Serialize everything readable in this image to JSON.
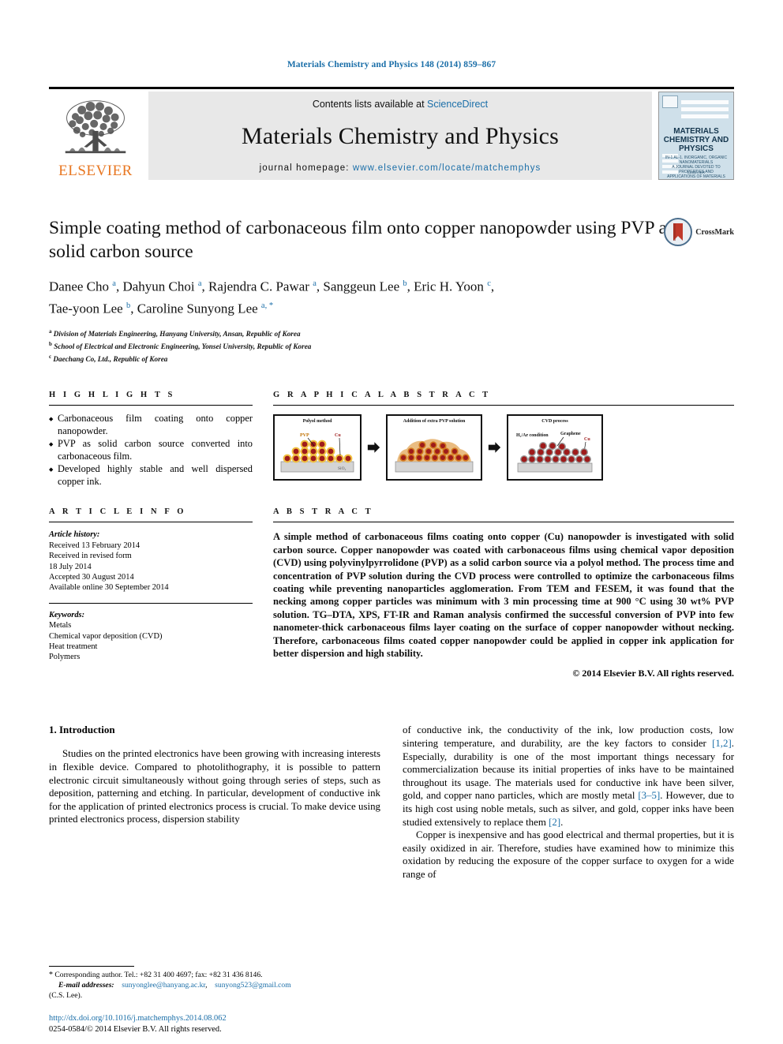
{
  "running_head": "Materials Chemistry and Physics 148 (2014) 859–867",
  "banner": {
    "publisher": "ELSEVIER",
    "contents_prefix": "Contents lists available at ",
    "contents_link": "ScienceDirect",
    "journal_title": "Materials Chemistry and Physics",
    "homepage_prefix": "journal homepage: ",
    "homepage_url": "www.elsevier.com/locate/matchemphys",
    "cover": {
      "title_line1": "MATERIALS",
      "title_line2": "CHEMISTRY AND",
      "title_line3": "PHYSICS",
      "sub_line1": "IN-1 AL-1. INORGANIC, ORGANIC",
      "sub_line2": "NANOMATERIALS",
      "sub_line3": "A JOURNAL DEVOTED TO PROPERTIES AND",
      "sub_line4": "APPLICATIONS OF MATERIALS SCIENCE",
      "footer": "ELSEVIER"
    }
  },
  "article": {
    "title": "Simple coating method of carbonaceous film onto copper nanopowder using PVP as solid carbon source",
    "crossmark_label": "CrossMark",
    "authors_line1": "Danee Cho <sup>a</sup>, Dahyun Choi <sup>a</sup>, Rajendra C. Pawar <sup>a</sup>, Sanggeun Lee <sup>b</sup>, Eric H. Yoon <sup>c</sup>,",
    "authors_line2": "Tae-yoon Lee <sup>b</sup>, Caroline Sunyong Lee <sup>a, *</sup>",
    "affiliations": [
      "<sup>a</sup> Division of Materials Engineering, Hanyang University, Ansan, Republic of Korea",
      "<sup>b</sup> School of Electrical and Electronic Engineering, Yonsei University, Republic of Korea",
      "<sup>c</sup> Daechang Co, Ltd., Republic of Korea"
    ]
  },
  "highlights": {
    "heading": "H I G H L I G H T S",
    "items": [
      "Carbonaceous film coating onto copper nanopowder.",
      "PVP as solid carbon source converted into carbonaceous film.",
      "Developed highly stable and well dispersed copper ink."
    ]
  },
  "graphical_abstract": {
    "heading": "G R A P H I C A L   A B S T R A C T",
    "panels": [
      {
        "caption": "Polyol method",
        "labels": [
          "PVP",
          "Cu",
          "SiO2"
        ]
      },
      {
        "caption": "Addition of extra PVP solution",
        "labels": []
      },
      {
        "caption": "CVD process",
        "labels": [
          "H2/Ar condition",
          "Graphene",
          "Cu"
        ]
      }
    ]
  },
  "article_info": {
    "heading": "A R T I C L E   I N F O",
    "history_label": "Article history:",
    "history": [
      "Received 13 February 2014",
      "Received in revised form",
      "18 July 2014",
      "Accepted 30 August 2014",
      "Available online 30 September 2014"
    ],
    "keywords_label": "Keywords:",
    "keywords": [
      "Metals",
      "Chemical vapor deposition (CVD)",
      "Heat treatment",
      "Polymers"
    ]
  },
  "abstract": {
    "heading": "A B S T R A C T",
    "text": "A simple method of carbonaceous films coating onto copper (Cu) nanopowder is investigated with solid carbon source. Copper nanopowder was coated with carbonaceous films using chemical vapor deposition (CVD) using polyvinylpyrrolidone (PVP) as a solid carbon source via a polyol method. The process time and concentration of PVP solution during the CVD process were controlled to optimize the carbonaceous films coating while preventing nanoparticles agglomeration. From TEM and FESEM, it was found that the necking among copper particles was minimum with 3 min processing time at 900 °C using 30 wt% PVP solution. TG–DTA, XPS, FT-IR and Raman analysis confirmed the successful conversion of PVP into few nanometer-thick carbonaceous films layer coating on the surface of copper nanopowder without necking. Therefore, carbonaceous films coated copper nanopowder could be applied in copper ink application for better dispersion and high stability.",
    "copyright": "© 2014 Elsevier B.V. All rights reserved."
  },
  "introduction": {
    "number_title": "1.  Introduction",
    "left_para": "Studies on the printed electronics have been growing with increasing interests in flexible device. Compared to photolithography, it is possible to pattern electronic circuit simultaneously without going through series of steps, such as deposition, patterning and etching. In particular, development of conductive ink for the application of printed electronics process is crucial. To make device using printed electronics process, dispersion stability",
    "right_para_1_a": "of conductive ink, the conductivity of the ink, low production costs, low sintering temperature, and durability, are the key factors to consider ",
    "right_para_1_ref1": "[1,2]",
    "right_para_1_b": ". Especially, durability is one of the most important things necessary for commercialization because its initial properties of inks have to be maintained throughout its usage. The materials used for conductive ink have been silver, gold, and copper nano particles, which are mostly metal ",
    "right_para_1_ref2": "[3–5]",
    "right_para_1_c": ". However, due to its high cost using noble metals, such as silver, and gold, copper inks have been studied extensively to replace them ",
    "right_para_1_ref3": "[2]",
    "right_para_1_d": ".",
    "right_para_2": "Copper is inexpensive and has good electrical and thermal properties, but it is easily oxidized in air. Therefore, studies have examined how to minimize this oxidation by reducing the exposure of the copper surface to oxygen for a wide range of"
  },
  "footnote": {
    "star": "*",
    "corresponding": " Corresponding author. Tel.: +82 31 400 4697; fax: +82 31 436 8146.",
    "email_label": "E-mail addresses:",
    "email1": "sunyonglee@hanyang.ac.kr",
    "email2": "sunyong523@gmail.com",
    "email_suffix": "(C.S. Lee).",
    "doi": "http://dx.doi.org/10.1016/j.matchemphys.2014.08.062",
    "issn_line": "0254-0584/© 2014 Elsevier B.V. All rights reserved."
  },
  "colors": {
    "link_blue": "#1a6ea8",
    "elsevier_orange": "#E87722",
    "banner_grey": "#e8e8e8",
    "copper_red": "#9e1b1b",
    "pvp_gold": "#f0c040"
  }
}
